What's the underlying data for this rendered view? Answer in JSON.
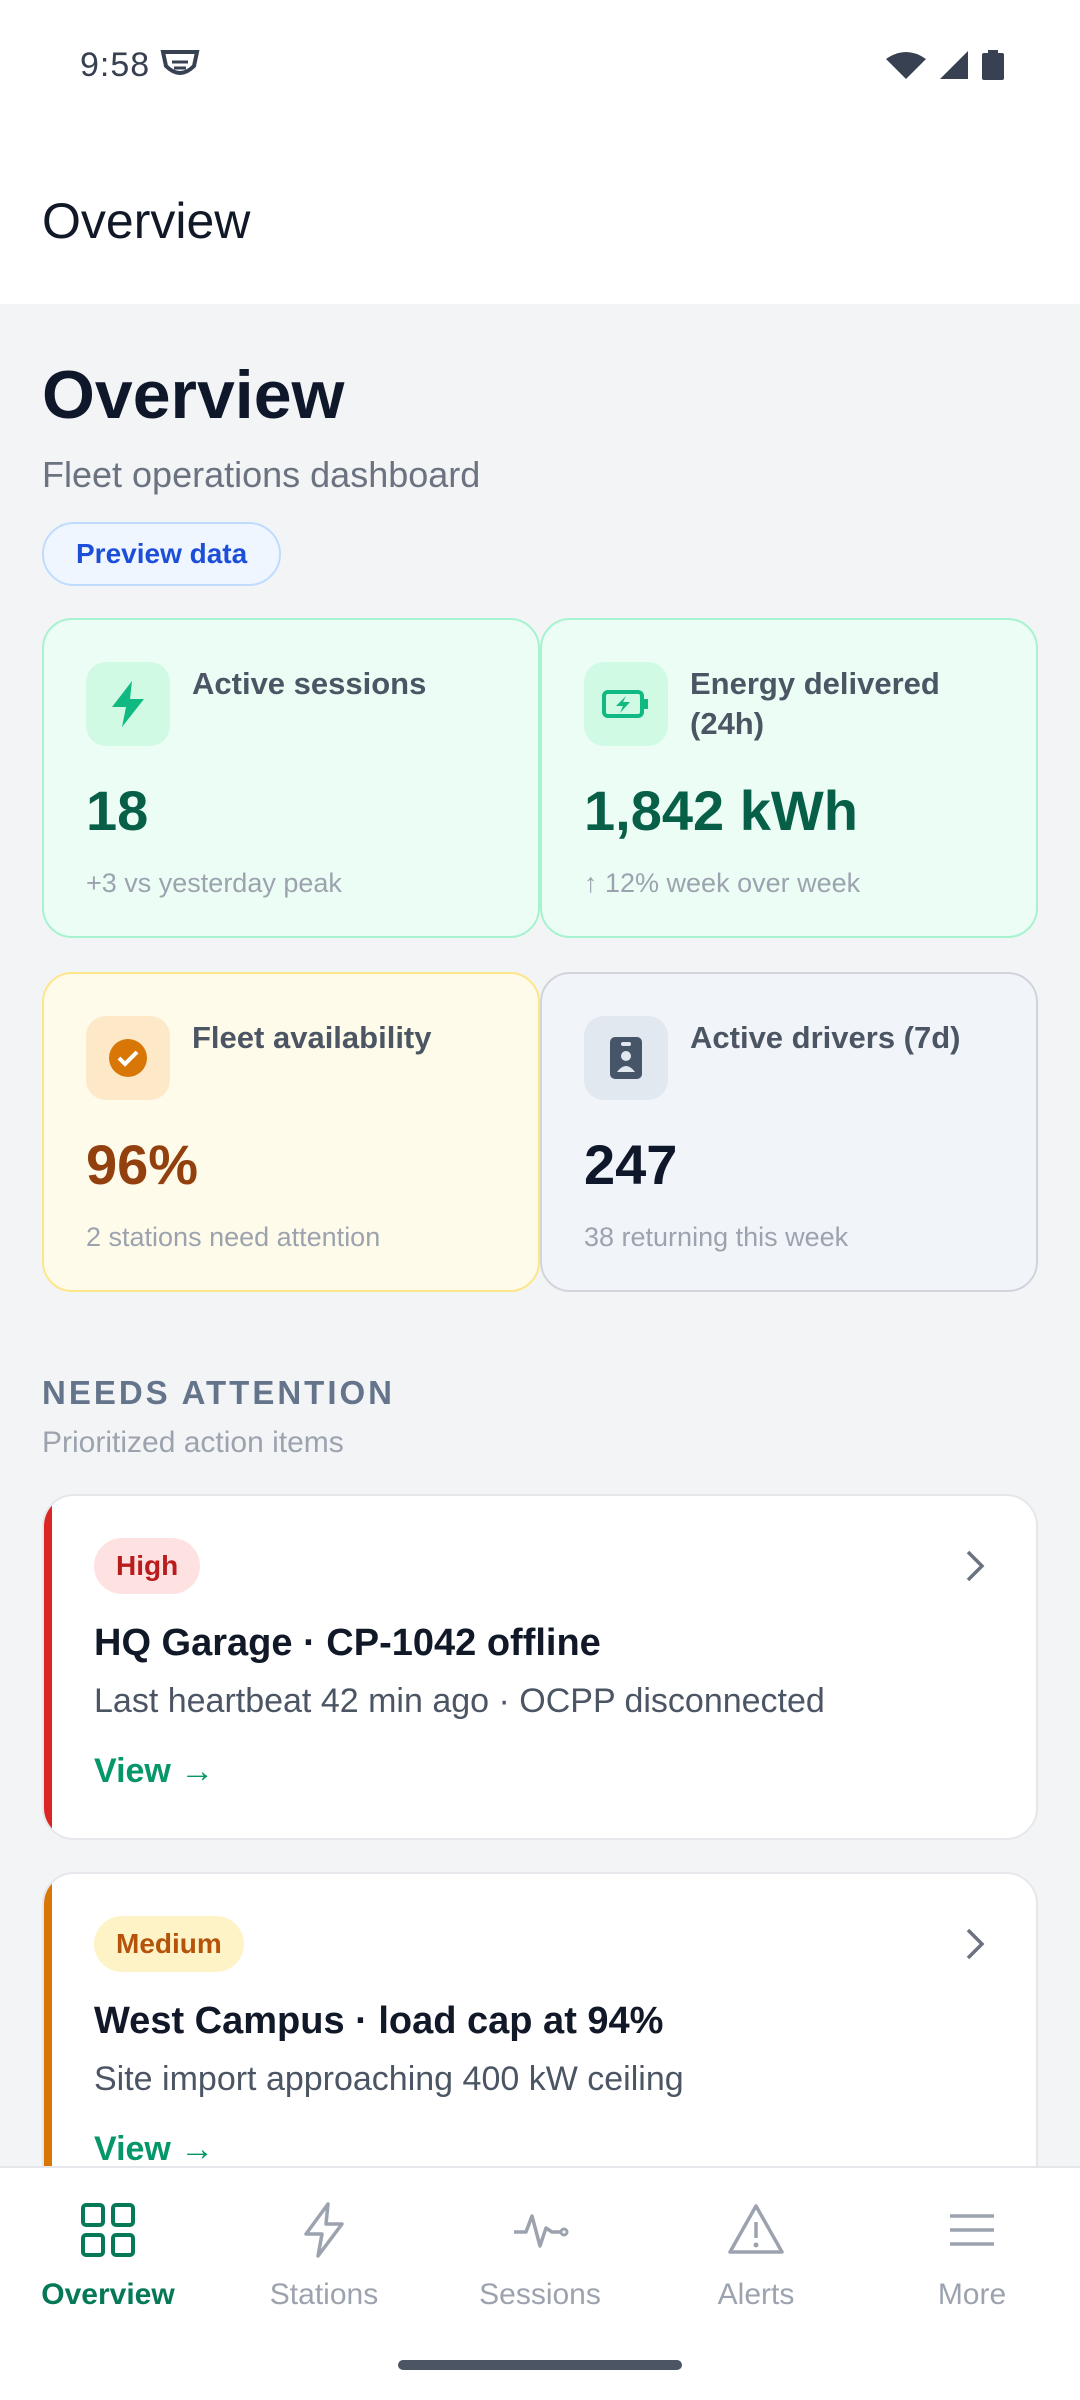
{
  "status_bar": {
    "time": "9:58"
  },
  "app_bar": {
    "title": "Overview"
  },
  "page": {
    "title": "Overview",
    "subtitle": "Fleet operations dashboard",
    "chip": "Preview data"
  },
  "metrics": [
    {
      "label": "Active sessions",
      "value": "18",
      "note": "+3 vs yesterday peak",
      "icon": "bolt-icon"
    },
    {
      "label": "Energy delivered (24h)",
      "value": "1,842 kWh",
      "note": "↑ 12% week over week",
      "icon": "battery-charging-icon"
    },
    {
      "label": "Fleet availability",
      "value": "96%",
      "note": "2 stations need attention",
      "icon": "check-circle-icon"
    },
    {
      "label": "Active drivers (7d)",
      "value": "247",
      "note": "38 returning this week",
      "icon": "badge-icon"
    }
  ],
  "attention": {
    "title": "NEEDS ATTENTION",
    "subtitle": "Prioritized action items",
    "items": [
      {
        "priority": "High",
        "title": "HQ Garage · CP-1042 offline",
        "description": "Last heartbeat 42 min ago · OCPP disconnected",
        "link": "View →"
      },
      {
        "priority": "Medium",
        "title": "West Campus · load cap at 94%",
        "description": "Site import approaching 400 kW ceiling",
        "link": "View →"
      }
    ]
  },
  "nav": [
    {
      "label": "Overview",
      "icon": "grid-icon",
      "active": true
    },
    {
      "label": "Stations",
      "icon": "bolt-icon"
    },
    {
      "label": "Sessions",
      "icon": "activity-icon"
    },
    {
      "label": "Alerts",
      "icon": "warning-icon"
    },
    {
      "label": "More",
      "icon": "menu-icon"
    }
  ],
  "colors": {
    "accent": "#059669",
    "high": "#dc2626",
    "medium": "#d97706"
  }
}
